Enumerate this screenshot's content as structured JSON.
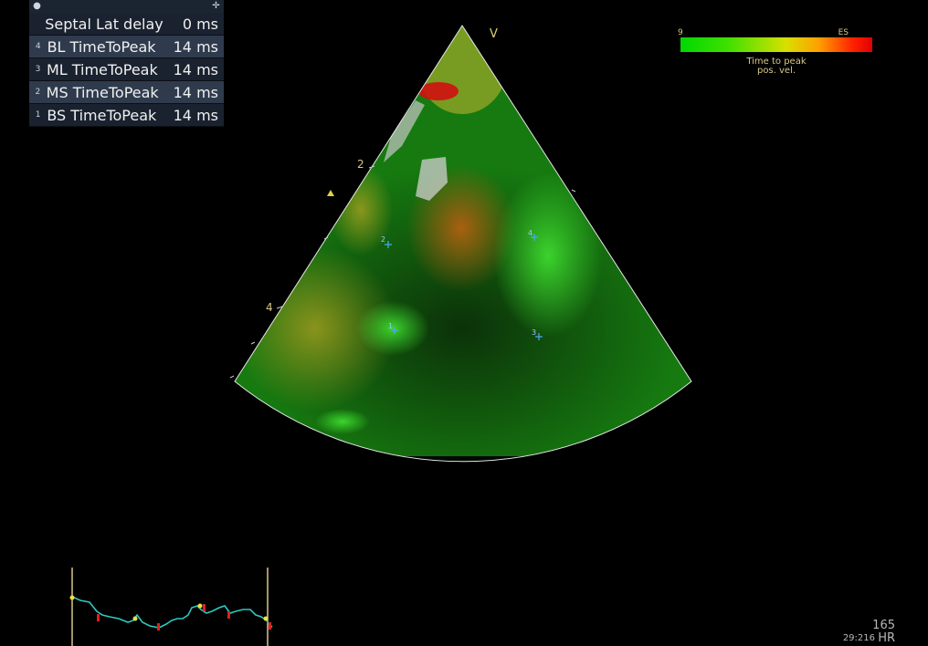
{
  "measurements": {
    "rows": [
      {
        "index": "",
        "label": "Septal Lat delay",
        "value": "0 ms"
      },
      {
        "index": "4",
        "label": "BL TimeToPeak",
        "value": "14 ms"
      },
      {
        "index": "3",
        "label": "ML TimeToPeak",
        "value": "14 ms"
      },
      {
        "index": "2",
        "label": "MS TimeToPeak",
        "value": "14 ms"
      },
      {
        "index": "1",
        "label": "BS TimeToPeak",
        "value": "14 ms"
      }
    ]
  },
  "colorbar": {
    "low_label": "9",
    "high_label": "ES",
    "caption_line1": "Time to peak",
    "caption_line2": "pos. vel."
  },
  "image": {
    "v_marker": "V",
    "depth_marks": [
      "2",
      "4"
    ],
    "roi_markers": [
      "1",
      "2",
      "3",
      "4"
    ]
  },
  "status": {
    "hr_value": "165",
    "time": "29:216",
    "hr_label": "HR"
  },
  "colors": {
    "accent_yellow": "#d8c88a",
    "panel_dark": "#1a2230",
    "panel_light": "#2f3b4d",
    "ecg_trace": "#2fc8c0"
  }
}
